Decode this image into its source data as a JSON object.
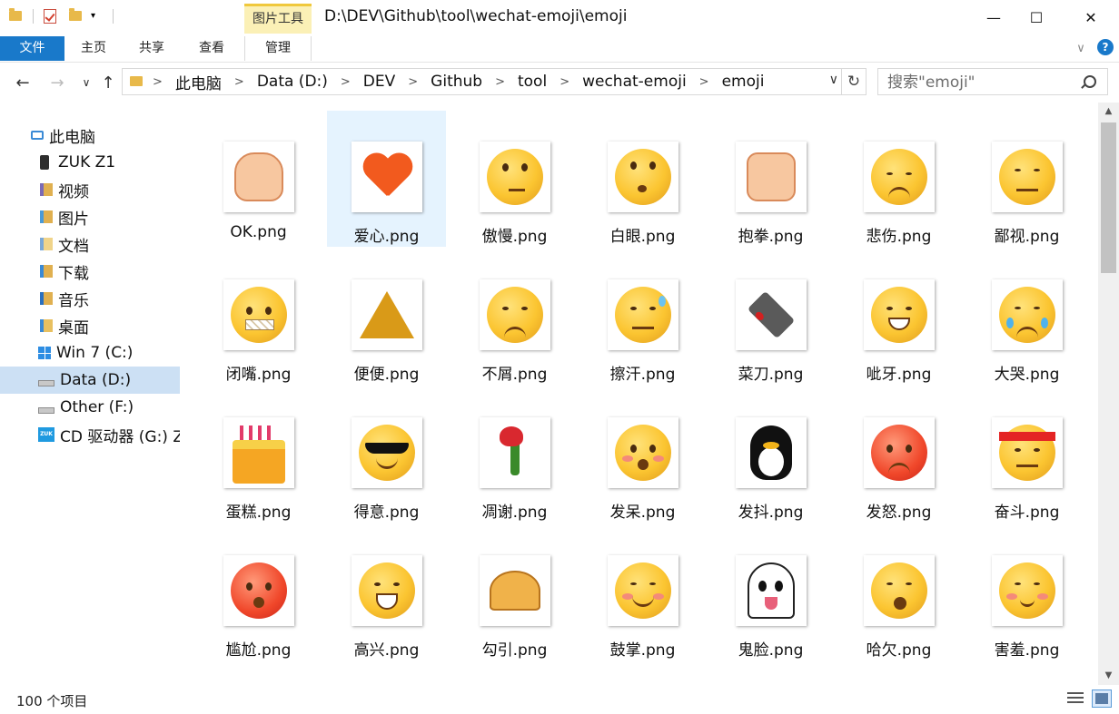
{
  "titlebar": {
    "picture_tools": "图片工具",
    "path_title": "D:\\DEV\\Github\\tool\\wechat-emoji\\emoji",
    "minimize": "—",
    "maximize": "☐",
    "close": "✕"
  },
  "ribbon": {
    "file": "文件",
    "tabs": [
      "主页",
      "共享",
      "查看",
      "管理"
    ],
    "collapse": "∨",
    "help": "?"
  },
  "address": {
    "back": "←",
    "forward": "→",
    "recent": "∨",
    "up": "↑",
    "crumbs": [
      "此电脑",
      "Data (D:)",
      "DEV",
      "Github",
      "tool",
      "wechat-emoji",
      "emoji"
    ],
    "dropdown": "∨",
    "refresh": "↻"
  },
  "search": {
    "placeholder": "搜索\"emoji\""
  },
  "nav": {
    "items": [
      {
        "label": "此电脑",
        "icon": "computer-icon"
      },
      {
        "label": "ZUK Z1",
        "icon": "phone-icon"
      },
      {
        "label": "视频",
        "icon": "videos-icon"
      },
      {
        "label": "图片",
        "icon": "pictures-icon"
      },
      {
        "label": "文档",
        "icon": "documents-icon"
      },
      {
        "label": "下载",
        "icon": "downloads-icon"
      },
      {
        "label": "音乐",
        "icon": "music-icon"
      },
      {
        "label": "桌面",
        "icon": "desktop-icon"
      },
      {
        "label": "Win 7 (C:)",
        "icon": "windows-drive-icon"
      },
      {
        "label": "Data (D:)",
        "icon": "drive-icon",
        "selected": true
      },
      {
        "label": "Other (F:)",
        "icon": "drive-icon"
      },
      {
        "label": "CD 驱动器 (G:) Z",
        "icon": "cd-drive-icon",
        "badge": "ZUK"
      }
    ]
  },
  "files": [
    {
      "name": "OK.png",
      "emoji": "ok-hand"
    },
    {
      "name": "爱心.png",
      "emoji": "heart",
      "selected": true
    },
    {
      "name": "傲慢.png",
      "emoji": "arrogant"
    },
    {
      "name": "白眼.png",
      "emoji": "eye-roll"
    },
    {
      "name": "抱拳.png",
      "emoji": "fist-salute"
    },
    {
      "name": "悲伤.png",
      "emoji": "sad"
    },
    {
      "name": "鄙视.png",
      "emoji": "contempt"
    },
    {
      "name": "闭嘴.png",
      "emoji": "shut-mouth"
    },
    {
      "name": "便便.png",
      "emoji": "poop"
    },
    {
      "name": "不屑.png",
      "emoji": "disdain"
    },
    {
      "name": "擦汗.png",
      "emoji": "wipe-sweat"
    },
    {
      "name": "菜刀.png",
      "emoji": "cleaver"
    },
    {
      "name": "呲牙.png",
      "emoji": "grin"
    },
    {
      "name": "大哭.png",
      "emoji": "cry"
    },
    {
      "name": "蛋糕.png",
      "emoji": "cake"
    },
    {
      "name": "得意.png",
      "emoji": "cool"
    },
    {
      "name": "凋谢.png",
      "emoji": "wilted-rose"
    },
    {
      "name": "发呆.png",
      "emoji": "daze"
    },
    {
      "name": "发抖.png",
      "emoji": "penguin-shiver"
    },
    {
      "name": "发怒.png",
      "emoji": "angry"
    },
    {
      "name": "奋斗.png",
      "emoji": "determined"
    },
    {
      "name": "尴尬.png",
      "emoji": "awkward"
    },
    {
      "name": "高兴.png",
      "emoji": "happy"
    },
    {
      "name": "勾引.png",
      "emoji": "beckon"
    },
    {
      "name": "鼓掌.png",
      "emoji": "applause"
    },
    {
      "name": "鬼脸.png",
      "emoji": "ghost"
    },
    {
      "name": "哈欠.png",
      "emoji": "yawn"
    },
    {
      "name": "害羞.png",
      "emoji": "shy"
    }
  ],
  "scroll": {
    "up": "▲",
    "down": "▼"
  },
  "status": {
    "item_count": "100 个项目"
  }
}
